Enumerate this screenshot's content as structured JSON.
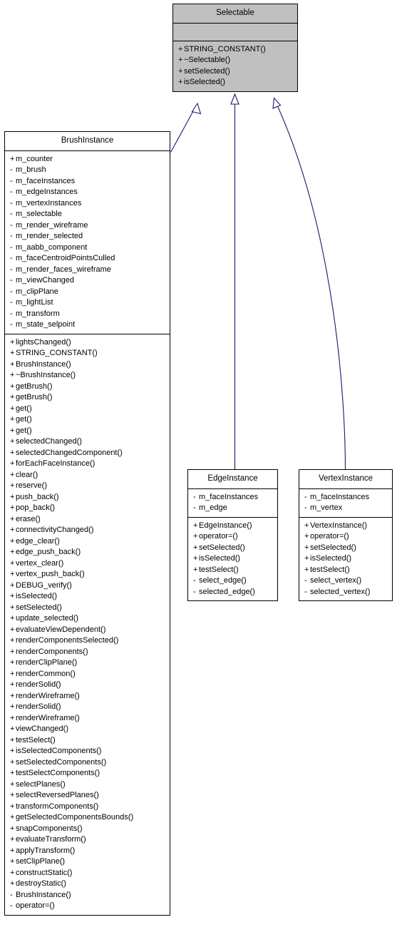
{
  "diagram": {
    "type": "uml-class-inheritance",
    "title": "Selectable inheritance diagram",
    "colors": {
      "base_class_fill": "#c0c0c0",
      "derived_class_fill": "#ffffff",
      "border": "#000000",
      "edge_line": "#191970",
      "text": "#000000"
    },
    "relationships": [
      {
        "from": "BrushInstance",
        "to": "Selectable",
        "kind": "generalization"
      },
      {
        "from": "EdgeInstance",
        "to": "Selectable",
        "kind": "generalization"
      },
      {
        "from": "VertexInstance",
        "to": "Selectable",
        "kind": "generalization"
      }
    ]
  },
  "classes": {
    "selectable": {
      "name": "Selectable",
      "attributes": [],
      "methods": [
        {
          "visibility": "+",
          "label": "STRING_CONSTANT()"
        },
        {
          "visibility": "+",
          "label": "~Selectable()"
        },
        {
          "visibility": "+",
          "label": "setSelected()"
        },
        {
          "visibility": "+",
          "label": "isSelected()"
        }
      ]
    },
    "brushinstance": {
      "name": "BrushInstance",
      "attributes": [
        {
          "visibility": "+",
          "label": "m_counter"
        },
        {
          "visibility": "-",
          "label": "m_brush"
        },
        {
          "visibility": "-",
          "label": "m_faceInstances"
        },
        {
          "visibility": "-",
          "label": "m_edgeInstances"
        },
        {
          "visibility": "-",
          "label": "m_vertexInstances"
        },
        {
          "visibility": "-",
          "label": "m_selectable"
        },
        {
          "visibility": "-",
          "label": "m_render_wireframe"
        },
        {
          "visibility": "-",
          "label": "m_render_selected"
        },
        {
          "visibility": "-",
          "label": "m_aabb_component"
        },
        {
          "visibility": "-",
          "label": "m_faceCentroidPointsCulled"
        },
        {
          "visibility": "-",
          "label": "m_render_faces_wireframe"
        },
        {
          "visibility": "-",
          "label": "m_viewChanged"
        },
        {
          "visibility": "-",
          "label": "m_clipPlane"
        },
        {
          "visibility": "-",
          "label": "m_lightList"
        },
        {
          "visibility": "-",
          "label": "m_transform"
        },
        {
          "visibility": "-",
          "label": "m_state_selpoint"
        }
      ],
      "methods": [
        {
          "visibility": "+",
          "label": "lightsChanged()"
        },
        {
          "visibility": "+",
          "label": "STRING_CONSTANT()"
        },
        {
          "visibility": "+",
          "label": "BrushInstance()"
        },
        {
          "visibility": "+",
          "label": "~BrushInstance()"
        },
        {
          "visibility": "+",
          "label": "getBrush()"
        },
        {
          "visibility": "+",
          "label": "getBrush()"
        },
        {
          "visibility": "+",
          "label": "get()"
        },
        {
          "visibility": "+",
          "label": "get()"
        },
        {
          "visibility": "+",
          "label": "get()"
        },
        {
          "visibility": "+",
          "label": "selectedChanged()"
        },
        {
          "visibility": "+",
          "label": "selectedChangedComponent()"
        },
        {
          "visibility": "+",
          "label": "forEachFaceInstance()"
        },
        {
          "visibility": "+",
          "label": "clear()"
        },
        {
          "visibility": "+",
          "label": "reserve()"
        },
        {
          "visibility": "+",
          "label": "push_back()"
        },
        {
          "visibility": "+",
          "label": "pop_back()"
        },
        {
          "visibility": "+",
          "label": "erase()"
        },
        {
          "visibility": "+",
          "label": "connectivityChanged()"
        },
        {
          "visibility": "+",
          "label": "edge_clear()"
        },
        {
          "visibility": "+",
          "label": "edge_push_back()"
        },
        {
          "visibility": "+",
          "label": "vertex_clear()"
        },
        {
          "visibility": "+",
          "label": "vertex_push_back()"
        },
        {
          "visibility": "+",
          "label": "DEBUG_verify()"
        },
        {
          "visibility": "+",
          "label": "isSelected()"
        },
        {
          "visibility": "+",
          "label": "setSelected()"
        },
        {
          "visibility": "+",
          "label": "update_selected()"
        },
        {
          "visibility": "+",
          "label": "evaluateViewDependent()"
        },
        {
          "visibility": "+",
          "label": "renderComponentsSelected()"
        },
        {
          "visibility": "+",
          "label": "renderComponents()"
        },
        {
          "visibility": "+",
          "label": "renderClipPlane()"
        },
        {
          "visibility": "+",
          "label": "renderCommon()"
        },
        {
          "visibility": "+",
          "label": "renderSolid()"
        },
        {
          "visibility": "+",
          "label": "renderWireframe()"
        },
        {
          "visibility": "+",
          "label": "renderSolid()"
        },
        {
          "visibility": "+",
          "label": "renderWireframe()"
        },
        {
          "visibility": "+",
          "label": "viewChanged()"
        },
        {
          "visibility": "+",
          "label": "testSelect()"
        },
        {
          "visibility": "+",
          "label": "isSelectedComponents()"
        },
        {
          "visibility": "+",
          "label": "setSelectedComponents()"
        },
        {
          "visibility": "+",
          "label": "testSelectComponents()"
        },
        {
          "visibility": "+",
          "label": "selectPlanes()"
        },
        {
          "visibility": "+",
          "label": "selectReversedPlanes()"
        },
        {
          "visibility": "+",
          "label": "transformComponents()"
        },
        {
          "visibility": "+",
          "label": "getSelectedComponentsBounds()"
        },
        {
          "visibility": "+",
          "label": "snapComponents()"
        },
        {
          "visibility": "+",
          "label": "evaluateTransform()"
        },
        {
          "visibility": "+",
          "label": "applyTransform()"
        },
        {
          "visibility": "+",
          "label": "setClipPlane()"
        },
        {
          "visibility": "+",
          "label": "constructStatic()"
        },
        {
          "visibility": "+",
          "label": "destroyStatic()"
        },
        {
          "visibility": "-",
          "label": "BrushInstance()"
        },
        {
          "visibility": "-",
          "label": "operator=()"
        }
      ]
    },
    "edgeinstance": {
      "name": "EdgeInstance",
      "attributes": [
        {
          "visibility": "-",
          "label": "m_faceInstances"
        },
        {
          "visibility": "-",
          "label": "m_edge"
        }
      ],
      "methods": [
        {
          "visibility": "+",
          "label": "EdgeInstance()"
        },
        {
          "visibility": "+",
          "label": "operator=()"
        },
        {
          "visibility": "+",
          "label": "setSelected()"
        },
        {
          "visibility": "+",
          "label": "isSelected()"
        },
        {
          "visibility": "+",
          "label": "testSelect()"
        },
        {
          "visibility": "-",
          "label": "select_edge()"
        },
        {
          "visibility": "-",
          "label": "selected_edge()"
        }
      ]
    },
    "vertexinstance": {
      "name": "VertexInstance",
      "attributes": [
        {
          "visibility": "-",
          "label": "m_faceInstances"
        },
        {
          "visibility": "-",
          "label": "m_vertex"
        }
      ],
      "methods": [
        {
          "visibility": "+",
          "label": "VertexInstance()"
        },
        {
          "visibility": "+",
          "label": "operator=()"
        },
        {
          "visibility": "+",
          "label": "setSelected()"
        },
        {
          "visibility": "+",
          "label": "isSelected()"
        },
        {
          "visibility": "+",
          "label": "testSelect()"
        },
        {
          "visibility": "-",
          "label": "select_vertex()"
        },
        {
          "visibility": "-",
          "label": "selected_vertex()"
        }
      ]
    }
  }
}
